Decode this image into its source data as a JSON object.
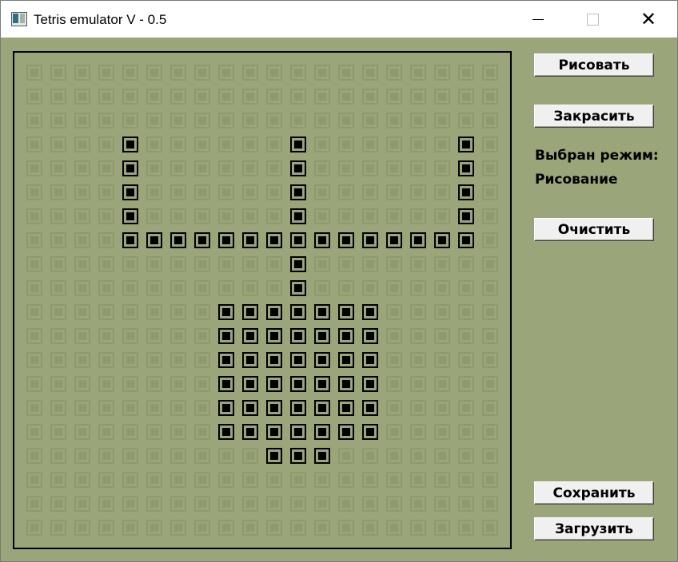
{
  "window": {
    "title": "Tetris emulator V - 0.5"
  },
  "sidebar": {
    "draw_label": "Рисовать",
    "fill_label": "Закрасить",
    "mode_caption": "Выбран режим:",
    "mode_value": "Рисование",
    "clear_label": "Очистить",
    "save_label": "Сохранить",
    "load_label": "Загрузить"
  },
  "grid": {
    "cols": 20,
    "rows": 20,
    "filled": [
      [
        3,
        4
      ],
      [
        3,
        11
      ],
      [
        3,
        18
      ],
      [
        4,
        4
      ],
      [
        4,
        11
      ],
      [
        4,
        18
      ],
      [
        5,
        4
      ],
      [
        5,
        11
      ],
      [
        5,
        18
      ],
      [
        6,
        4
      ],
      [
        6,
        11
      ],
      [
        6,
        18
      ],
      [
        7,
        4
      ],
      [
        7,
        5
      ],
      [
        7,
        6
      ],
      [
        7,
        7
      ],
      [
        7,
        8
      ],
      [
        7,
        9
      ],
      [
        7,
        10
      ],
      [
        7,
        11
      ],
      [
        7,
        12
      ],
      [
        7,
        13
      ],
      [
        7,
        14
      ],
      [
        7,
        15
      ],
      [
        7,
        16
      ],
      [
        7,
        17
      ],
      [
        7,
        18
      ],
      [
        8,
        11
      ],
      [
        9,
        11
      ],
      [
        10,
        8
      ],
      [
        10,
        9
      ],
      [
        10,
        10
      ],
      [
        10,
        11
      ],
      [
        10,
        12
      ],
      [
        10,
        13
      ],
      [
        10,
        14
      ],
      [
        11,
        8
      ],
      [
        11,
        9
      ],
      [
        11,
        10
      ],
      [
        11,
        11
      ],
      [
        11,
        12
      ],
      [
        11,
        13
      ],
      [
        11,
        14
      ],
      [
        12,
        8
      ],
      [
        12,
        9
      ],
      [
        12,
        10
      ],
      [
        12,
        11
      ],
      [
        12,
        12
      ],
      [
        12,
        13
      ],
      [
        12,
        14
      ],
      [
        13,
        8
      ],
      [
        13,
        9
      ],
      [
        13,
        10
      ],
      [
        13,
        11
      ],
      [
        13,
        12
      ],
      [
        13,
        13
      ],
      [
        13,
        14
      ],
      [
        14,
        8
      ],
      [
        14,
        9
      ],
      [
        14,
        10
      ],
      [
        14,
        11
      ],
      [
        14,
        12
      ],
      [
        14,
        13
      ],
      [
        14,
        14
      ],
      [
        15,
        8
      ],
      [
        15,
        9
      ],
      [
        15,
        10
      ],
      [
        15,
        11
      ],
      [
        15,
        12
      ],
      [
        15,
        13
      ],
      [
        15,
        14
      ],
      [
        16,
        10
      ],
      [
        16,
        11
      ],
      [
        16,
        12
      ]
    ]
  }
}
